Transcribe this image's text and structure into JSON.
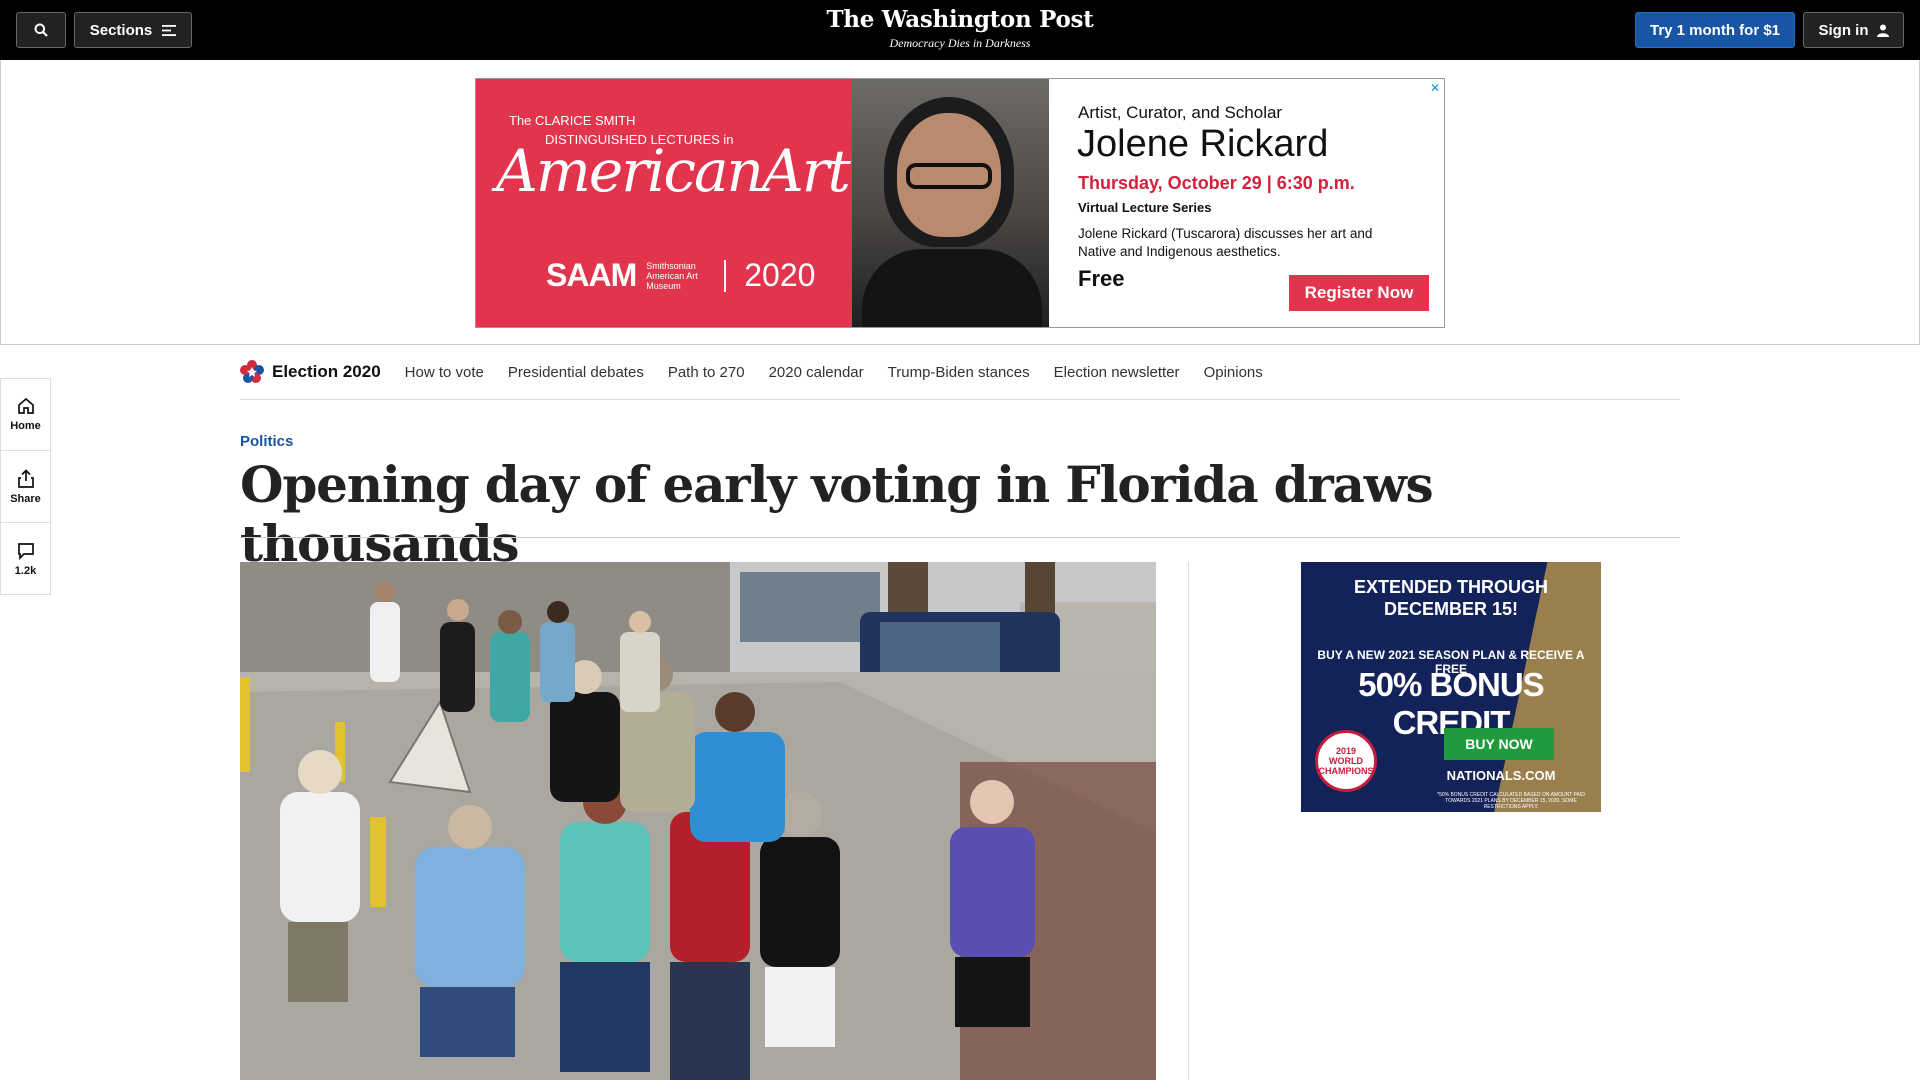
{
  "masthead": {
    "sections_label": "Sections",
    "logo_name": "The Washington Post",
    "logo_tagline": "Democracy Dies in Darkness",
    "subscribe_label": "Try 1 month for $1",
    "signin_label": "Sign in"
  },
  "top_ad": {
    "lecture_line1": "The CLARICE SMITH",
    "lecture_line2": "DISTINGUISHED LECTURES in",
    "script_title": "AmericanArt",
    "museum_logo": "SAAM",
    "museum_name": "Smithsonian American Art Museum",
    "year": "2020",
    "role": "Artist, Curator, and Scholar",
    "name": "Jolene Rickard",
    "when": "Thursday, October 29  |  6:30 p.m.",
    "series": "Virtual Lecture Series",
    "description": "Jolene Rickard (Tuscarora) discusses her art and Native and Indigenous aesthetics.",
    "price": "Free",
    "cta": "Register Now",
    "close": "✕",
    "brand_color": "#e3344d"
  },
  "election_nav": {
    "label": "Election 2020",
    "items": [
      "How to vote",
      "Presidential debates",
      "Path to 270",
      "2020 calendar",
      "Trump-Biden stances",
      "Election newsletter",
      "Opinions"
    ]
  },
  "rail": {
    "home": "Home",
    "share": "Share",
    "comments": "1.2k"
  },
  "article": {
    "kicker": "Politics",
    "headline": "Opening day of early voting in Florida draws thousands"
  },
  "side_ad": {
    "headline_1": "EXTENDED THROUGH",
    "headline_2": "DECEMBER 15!",
    "offer_line": "BUY A NEW 2021 SEASON PLAN & RECEIVE A FREE",
    "offer_big": "50% BONUS CREDIT",
    "cta": "BUY NOW",
    "site": "NATIONALS.COM",
    "badge_text": "2019 WORLD CHAMPIONS",
    "fine_print": "*50% BONUS CREDIT CALCULATED BASED ON AMOUNT PAID TOWARDS 2021 PLANS BY DECEMBER 15, 2020. SOME RESTRICTIONS APPLY."
  },
  "icons": [
    "search-icon",
    "menu-icon",
    "user-icon",
    "home-icon",
    "share-icon",
    "comment-icon",
    "election-star-icon",
    "ad-close-icon"
  ],
  "colors": {
    "masthead_bg": "#000000",
    "accent_blue": "#1955a5",
    "nats_navy": "#14225a"
  }
}
